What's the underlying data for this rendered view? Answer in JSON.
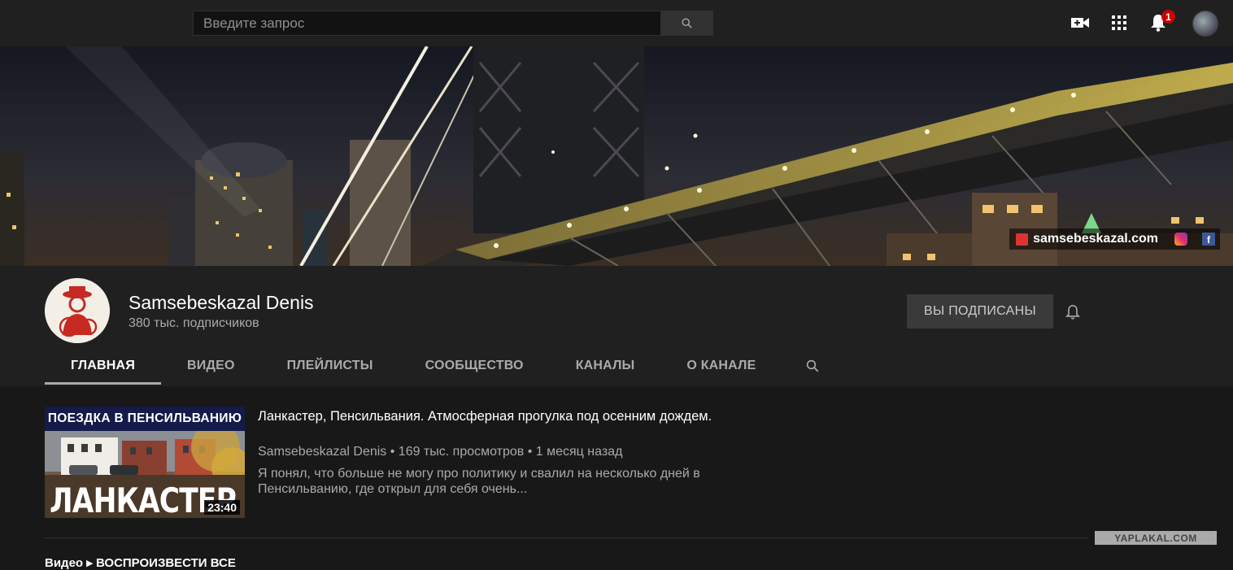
{
  "search": {
    "placeholder": "Введите запрос"
  },
  "notifications": {
    "count": "1"
  },
  "banner": {
    "site_link": "samsebeskazal.com"
  },
  "channel": {
    "name": "Samsebeskazal Denis",
    "subscribers": "380 тыс. подписчиков",
    "subscribed_label": "ВЫ ПОДПИСАНЫ"
  },
  "tabs": [
    {
      "label": "ГЛАВНАЯ"
    },
    {
      "label": "ВИДЕО"
    },
    {
      "label": "ПЛЕЙЛИСТЫ"
    },
    {
      "label": "СООБЩЕСТВО"
    },
    {
      "label": "КАНАЛЫ"
    },
    {
      "label": "О КАНАЛЕ"
    }
  ],
  "featured_video": {
    "thumb_top_text": "ПОЕЗДКА В ПЕНСИЛЬВАНИЮ",
    "thumb_big_text": "ЛАНКАСТЕР",
    "duration": "23:40",
    "title": "Ланкастер, Пенсильвания. Атмосферная прогулка под осенним дождем.",
    "meta": "Samsebeskazal Denis • 169 тыс. просмотров • 1 месяц назад",
    "description": "Я понял, что больше не могу про политику и свалил на несколько дней в Пенсильванию, где открыл для себя очень..."
  },
  "next_row": "Видео ▸ ВОСПРОИЗВЕСТИ ВСЕ",
  "watermark": "YAPLAKAL.COM",
  "icons": [
    "search-icon",
    "video-camera-icon",
    "apps-grid-icon",
    "bell-icon",
    "avatar"
  ]
}
